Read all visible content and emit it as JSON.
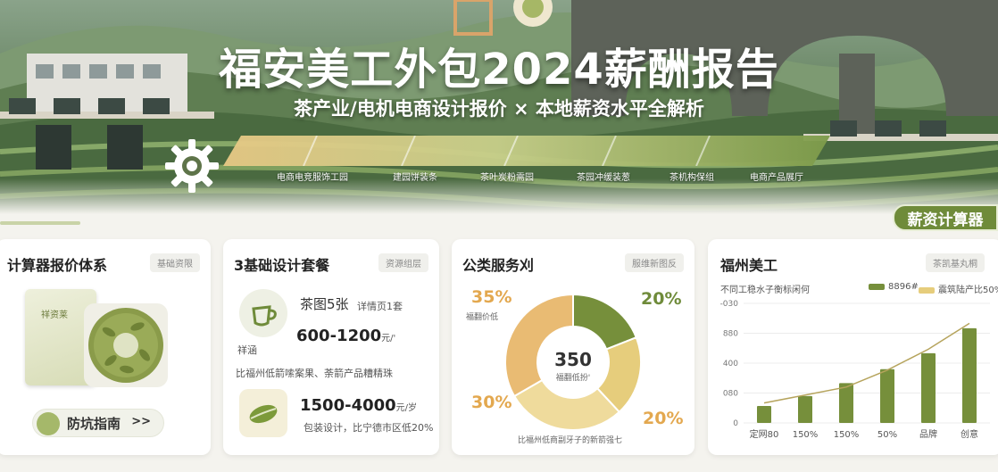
{
  "hero": {
    "title": "福安美工外包2024薪酬报告",
    "subtitle": "茶产业/电机电商设计报价 × 本地薪资水平全解析",
    "timeline_labels": [
      "电商电竞服饰工园",
      "建园饼装条",
      "茶叶炭粉需园",
      "茶园冲缓装葱",
      "茶机构保组",
      "电商产品展厅"
    ],
    "calc_badge": "薪资计算器"
  },
  "cards": {
    "card1": {
      "title": "计算器报价体系",
      "tag": "基础资限",
      "box_label": "祥资莱",
      "guide_button": "防坑指南",
      "guide_chevron": ">>"
    },
    "card2": {
      "title": "3基础设计套餐",
      "tag": "资源组层",
      "item1_main": "茶图5张",
      "item1_sub": "详情页1套",
      "item1_caption": "祥涵",
      "item1_price": "600-1200",
      "item1_unit": "元/'",
      "item1_note": "比福州低箭嗦案果、荼箭产品糟精珠",
      "item2_price": "1500-4000",
      "item2_unit": "元/岁",
      "item2_note": "包装设计，比宁德市区低20%"
    },
    "card3": {
      "title": "公类服务刈",
      "tag": "服维新图反",
      "center_value": "350",
      "center_caption": "福翻低扮'",
      "footer": "比福州低商副牙子的新箭强七"
    },
    "card4": {
      "title": "福州美工",
      "tag": "茶凯基丸桐",
      "subtitle": "不同工稳水子衡标闲何",
      "legend": [
        "8896#",
        "震筑陆产比50%"
      ]
    }
  },
  "chart_data": [
    {
      "type": "pie",
      "title": "公类服务刈",
      "values": [
        20,
        20,
        30,
        35
      ],
      "labels": [
        "20%",
        "20%",
        "30%",
        "35%"
      ],
      "captions": [
        "",
        "",
        "",
        "福翻价低"
      ],
      "colors": [
        "#768f3b",
        "#e6cd7c",
        "#efdb9c",
        "#e9bb73"
      ],
      "center_value": "350"
    },
    {
      "type": "bar",
      "title": "福州美工",
      "categories": [
        "定网80",
        "150%",
        "150%",
        "50%",
        "品牌",
        "创意"
      ],
      "values": [
        170,
        270,
        400,
        540,
        700,
        950
      ],
      "line_values": [
        200,
        280,
        360,
        530,
        740,
        1000
      ],
      "yticks": [
        "0",
        "080",
        "400",
        "880",
        "-030"
      ],
      "ylim": [
        0,
        1200
      ],
      "colors": {
        "bar": "#768f3b",
        "line": "#b6a45d"
      }
    }
  ]
}
